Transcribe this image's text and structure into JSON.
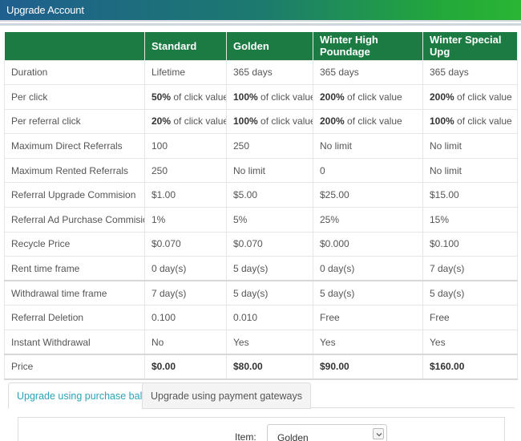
{
  "window": {
    "title": "Upgrade Account"
  },
  "plans": {
    "headers": [
      "",
      "Standard",
      "Golden",
      "Winter High Poundage",
      "Winter Special Upg"
    ],
    "rows": [
      {
        "label": "Duration",
        "cells": [
          {
            "bold": "",
            "rest": "Lifetime"
          },
          {
            "bold": "",
            "rest": "365 days"
          },
          {
            "bold": "",
            "rest": "365 days"
          },
          {
            "bold": "",
            "rest": "365 days"
          }
        ]
      },
      {
        "label": "Per click",
        "cells": [
          {
            "bold": "50%",
            "rest": " of click value"
          },
          {
            "bold": "100%",
            "rest": " of click value"
          },
          {
            "bold": "200%",
            "rest": " of click value"
          },
          {
            "bold": "200%",
            "rest": " of click value"
          }
        ]
      },
      {
        "label": "Per referral click",
        "cells": [
          {
            "bold": "20%",
            "rest": " of click value"
          },
          {
            "bold": "100%",
            "rest": " of click value"
          },
          {
            "bold": "200%",
            "rest": " of click value"
          },
          {
            "bold": "100%",
            "rest": " of click value"
          }
        ]
      },
      {
        "label": "Maximum Direct Referrals",
        "cells": [
          {
            "bold": "",
            "rest": "100"
          },
          {
            "bold": "",
            "rest": "250"
          },
          {
            "bold": "",
            "rest": "No limit"
          },
          {
            "bold": "",
            "rest": "No limit"
          }
        ]
      },
      {
        "label": "Maximum Rented Referrals",
        "cells": [
          {
            "bold": "",
            "rest": "250"
          },
          {
            "bold": "",
            "rest": "No limit"
          },
          {
            "bold": "",
            "rest": "0"
          },
          {
            "bold": "",
            "rest": "No limit"
          }
        ]
      },
      {
        "label": "Referral Upgrade Commision",
        "cells": [
          {
            "bold": "",
            "rest": "$1.00"
          },
          {
            "bold": "",
            "rest": "$5.00"
          },
          {
            "bold": "",
            "rest": "$25.00"
          },
          {
            "bold": "",
            "rest": "$15.00"
          }
        ]
      },
      {
        "label": "Referral Ad Purchase Commision",
        "cells": [
          {
            "bold": "",
            "rest": "1%"
          },
          {
            "bold": "",
            "rest": "5%"
          },
          {
            "bold": "",
            "rest": "25%"
          },
          {
            "bold": "",
            "rest": "15%"
          }
        ]
      },
      {
        "label": "Recycle Price",
        "cells": [
          {
            "bold": "",
            "rest": "$0.070"
          },
          {
            "bold": "",
            "rest": "$0.070"
          },
          {
            "bold": "",
            "rest": "$0.000"
          },
          {
            "bold": "",
            "rest": "$0.100"
          }
        ]
      },
      {
        "label": "Rent time frame",
        "cells": [
          {
            "bold": "",
            "rest": "0 day(s)"
          },
          {
            "bold": "",
            "rest": "5 day(s)"
          },
          {
            "bold": "",
            "rest": "0 day(s)"
          },
          {
            "bold": "",
            "rest": "7 day(s)"
          }
        ]
      },
      {
        "label": "Withdrawal time frame",
        "cells": [
          {
            "bold": "",
            "rest": "7 day(s)"
          },
          {
            "bold": "",
            "rest": "5 day(s)"
          },
          {
            "bold": "",
            "rest": "5 day(s)"
          },
          {
            "bold": "",
            "rest": "5 day(s)"
          }
        ]
      },
      {
        "label": "Referral Deletion",
        "cells": [
          {
            "bold": "",
            "rest": "0.100"
          },
          {
            "bold": "",
            "rest": "0.010"
          },
          {
            "bold": "",
            "rest": "Free"
          },
          {
            "bold": "",
            "rest": "Free"
          }
        ]
      },
      {
        "label": "Instant Withdrawal",
        "cells": [
          {
            "bold": "",
            "rest": "No"
          },
          {
            "bold": "",
            "rest": "Yes"
          },
          {
            "bold": "",
            "rest": "Yes"
          },
          {
            "bold": "",
            "rest": "Yes"
          }
        ]
      },
      {
        "label": "Price",
        "cells": [
          {
            "bold": "$0.00",
            "rest": ""
          },
          {
            "bold": "$80.00",
            "rest": ""
          },
          {
            "bold": "$90.00",
            "rest": ""
          },
          {
            "bold": "$160.00",
            "rest": ""
          }
        ]
      }
    ]
  },
  "tabs": {
    "purchase_balance": "Upgrade using purchase balance",
    "payment_gateways": "Upgrade using payment gateways"
  },
  "form": {
    "item_label": "Item:",
    "item_value": "Golden"
  },
  "colors": {
    "header_bg": "#1c7b43",
    "active_tab": "#2aa3b8"
  }
}
